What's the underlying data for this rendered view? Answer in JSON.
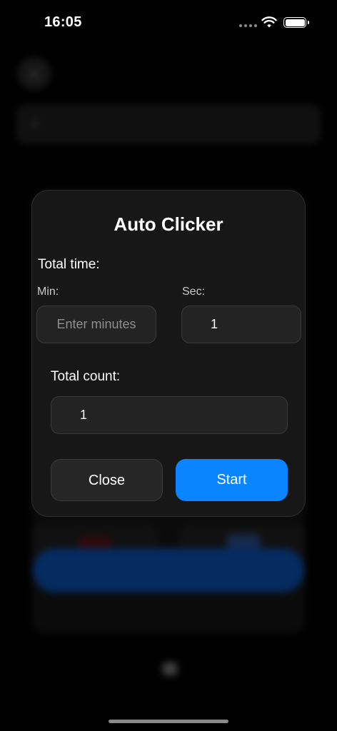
{
  "status_bar": {
    "time": "16:05",
    "wifi_icon": "wifi-icon",
    "battery_icon": "battery-icon"
  },
  "modal": {
    "title": "Auto Clicker",
    "total_time_label": "Total time:",
    "min_label": "Min:",
    "min_placeholder": "Enter minutes",
    "min_value": "",
    "sec_label": "Sec:",
    "sec_value": "1",
    "total_count_label": "Total count:",
    "total_count_value": "1",
    "close_label": "Close",
    "start_label": "Start"
  },
  "colors": {
    "accent": "#0a84ff",
    "background": "#000000",
    "modal_bg": "#171717"
  }
}
